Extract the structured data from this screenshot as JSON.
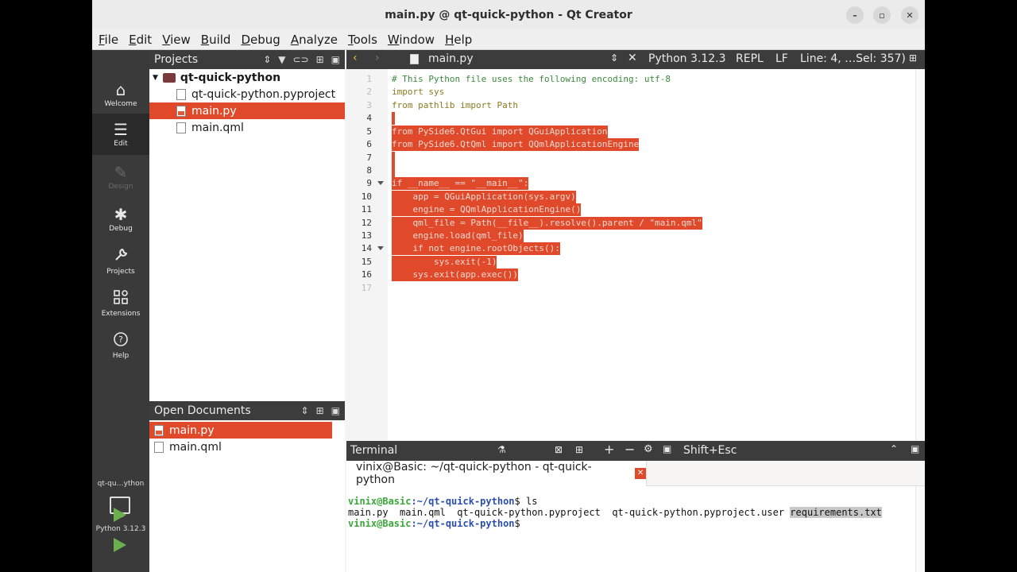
{
  "window": {
    "title": "main.py @ qt-quick-python - Qt Creator",
    "controls": [
      "–",
      "▫",
      "✕"
    ]
  },
  "menu": [
    "File",
    "Edit",
    "View",
    "Build",
    "Debug",
    "Analyze",
    "Tools",
    "Window",
    "Help"
  ],
  "modes": [
    {
      "label": "Welcome",
      "icon": "home-icon",
      "glyph": "⌂"
    },
    {
      "label": "Edit",
      "icon": "edit-icon",
      "glyph": "☰"
    },
    {
      "label": "Design",
      "icon": "design-icon",
      "glyph": "✎"
    },
    {
      "label": "Debug",
      "icon": "bug-icon",
      "glyph": "✱"
    },
    {
      "label": "Projects",
      "icon": "wrench-icon",
      "glyph": "🔧"
    },
    {
      "label": "Extensions",
      "icon": "extensions-icon",
      "glyph": "⊞"
    },
    {
      "label": "Help",
      "icon": "help-icon",
      "glyph": "?"
    }
  ],
  "kit": {
    "project": "qt-qu…ython",
    "python": "Python 3.12.3"
  },
  "projects": {
    "title": "Projects",
    "root": "qt-quick-python",
    "files": [
      "qt-quick-python.pyproject",
      "main.py",
      "main.qml"
    ]
  },
  "open_documents": {
    "title": "Open Documents",
    "files": [
      "main.py",
      "main.qml"
    ]
  },
  "editor": {
    "filename": "main.py",
    "interpreter": "Python 3.12.3",
    "repl": "REPL",
    "line_ending": "LF",
    "position": "Line: 4, …Sel: 357)",
    "lines": [
      "# This Python file uses the following encoding: utf-8",
      "import sys",
      "from pathlib import Path",
      "",
      "from PySide6.QtGui import QGuiApplication",
      "from PySide6.QtQml import QQmlApplicationEngine",
      "",
      "",
      "if __name__ == \"__main__\":",
      "    app = QGuiApplication(sys.argv)",
      "    engine = QQmlApplicationEngine()",
      "    qml_file = Path(__file__).resolve().parent / \"main.qml\"",
      "    engine.load(qml_file)",
      "    if not engine.rootObjects():",
      "        sys.exit(-1)",
      "    sys.exit(app.exec())",
      ""
    ],
    "line_numbers": [
      "1",
      "2",
      "3",
      "4",
      "5",
      "6",
      "7",
      "8",
      "9",
      "10",
      "11",
      "12",
      "13",
      "14",
      "15",
      "16",
      "17"
    ]
  },
  "terminal": {
    "title": "Terminal",
    "shortcut": "Shift+Esc",
    "tab": "vinix@Basic: ~/qt-quick-python - qt-quick-python",
    "user_host": "vinix@Basic",
    "path": ":~/qt-quick-python",
    "cmd1": "$ ls",
    "listing": "main.py  main.qml  qt-quick-python.pyproject  qt-quick-python.pyproject.user ",
    "listing_hl": "requirements.txt",
    "prompt2_end": "$"
  }
}
